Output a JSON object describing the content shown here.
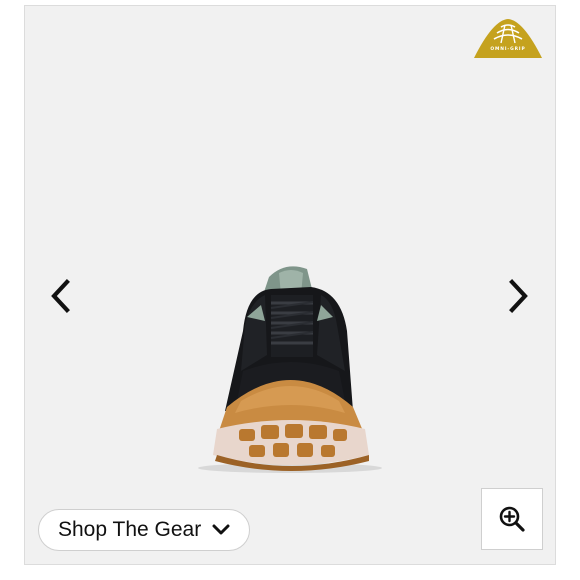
{
  "badge": {
    "text": "OMNI-GRIP",
    "color": "#c5a21e"
  },
  "gallery": {
    "prev_icon": "chevron-left-icon",
    "next_icon": "chevron-right-icon",
    "product": "trail running shoe, front view"
  },
  "shop_button": {
    "label": "Shop The Gear",
    "icon": "chevron-down-icon"
  },
  "zoom_button": {
    "icon": "zoom-in-icon"
  },
  "colors": {
    "background": "#f1f1f1",
    "upper": "#16171a",
    "accent": "#8fa599",
    "outsole": "#c98b42",
    "midsole": "#e8d6cc"
  }
}
